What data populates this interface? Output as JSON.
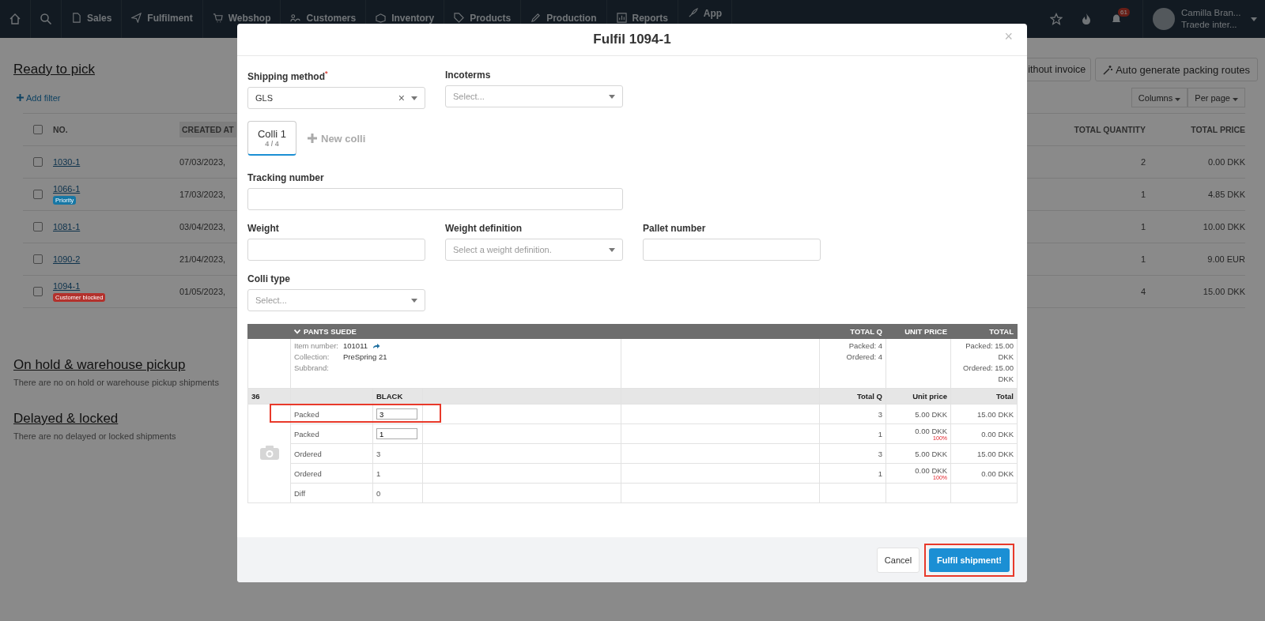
{
  "nav": {
    "items": [
      {
        "label": "Sales"
      },
      {
        "label": "Fulfilment"
      },
      {
        "label": "Webshop"
      },
      {
        "label": "Customers"
      },
      {
        "label": "Inventory"
      },
      {
        "label": "Products"
      },
      {
        "label": "Production"
      },
      {
        "label": "Reports"
      },
      {
        "label": "App"
      }
    ],
    "notification_count": "61",
    "user": {
      "name": "Camilla Bran...",
      "company": "Traede inter..."
    }
  },
  "page": {
    "title": "Ready to pick",
    "add_filter": "Add filter",
    "buttons": [
      "ithout invoice",
      "Auto generate packing routes"
    ],
    "table_controls": [
      "Columns",
      "Per page"
    ],
    "columns": [
      "NO.",
      "CREATED AT",
      "TOTAL QUANTITY",
      "TOTAL PRICE"
    ],
    "header_checked": false,
    "rows": [
      {
        "checked": false,
        "no": "1030-1",
        "created": "07/03/2023,",
        "quantity": "2",
        "price": "0.00 DKK"
      },
      {
        "checked": false,
        "no": "1066-1",
        "tag": {
          "label": "Priority",
          "color": "#1677a5"
        },
        "created": "17/03/2023,",
        "quantity": "1",
        "price": "4.85 DKK"
      },
      {
        "checked": false,
        "no": "1081-1",
        "created": "03/04/2023,",
        "quantity": "1",
        "price": "10.00 DKK"
      },
      {
        "checked": false,
        "no": "1090-2",
        "created": "21/04/2023,",
        "quantity": "1",
        "price": "9.00 EUR"
      },
      {
        "checked": false,
        "no": "1094-1",
        "tag": {
          "label": "Customer blocked",
          "color": "#b3312c"
        },
        "created": "01/05/2023,",
        "quantity": "4",
        "price": "15.00 DKK"
      }
    ],
    "sections": [
      {
        "title": "On hold & warehouse pickup",
        "empty_text": "There are no on hold or warehouse pickup shipments"
      },
      {
        "title": "Delayed & locked",
        "empty_text": "There are no delayed or locked shipments"
      }
    ]
  },
  "modal": {
    "title": "Fulfil 1094-1",
    "close": "×",
    "shipping_method": {
      "label": "Shipping method",
      "required_mark": "*",
      "value": "GLS",
      "clear": "×"
    },
    "incoterms": {
      "label": "Incoterms",
      "placeholder": "Select..."
    },
    "colli_tabs": [
      {
        "label": "Colli 1",
        "count": "4 / 4",
        "selected": true
      }
    ],
    "new_colli": "New colli",
    "tracking_number": {
      "label": "Tracking number"
    },
    "weight": {
      "label": "Weight"
    },
    "weight_definition": {
      "label": "Weight definition",
      "placeholder": "Select a weight definition."
    },
    "pallet_number": {
      "label": "Pallet number"
    },
    "colli_type": {
      "label": "Colli type",
      "placeholder": "Select..."
    },
    "product": {
      "name": "PANTS SUEDE",
      "columns": [
        "TOTAL Q",
        "UNIT PRICE",
        "TOTAL"
      ],
      "info": [
        {
          "label": "Item number:",
          "value": "101011",
          "link": true
        },
        {
          "label": "Collection:",
          "value": "PreSpring 21",
          "link": false
        },
        {
          "label": "Subbrand:",
          "link": false
        }
      ],
      "total_q": [
        "Packed: 4",
        "Ordered: 4"
      ],
      "total": [
        "Packed: 15.00 DKK",
        "Ordered: 15.00 DKK"
      ],
      "size": "36",
      "variant": "BLACK",
      "variant_columns": [
        "Total Q",
        "Unit price",
        "Total"
      ],
      "lines": [
        {
          "kind": "input",
          "label": "Packed",
          "value": "3",
          "total_q": "3",
          "unit_price": "5.00 DKK",
          "total": "15.00 DKK",
          "highlighted": true
        },
        {
          "kind": "input",
          "label": "Packed",
          "value": "1",
          "total_q": "1",
          "unit_price": "0.00 DKK",
          "discount": "100%",
          "total": "0.00 DKK",
          "highlighted": false
        },
        {
          "kind": "text",
          "label": "Ordered",
          "value": "3",
          "total_q": "3",
          "unit_price": "5.00 DKK",
          "total": "15.00 DKK",
          "highlighted": false
        },
        {
          "kind": "text",
          "label": "Ordered",
          "value": "1",
          "total_q": "1",
          "unit_price": "0.00 DKK",
          "discount": "100%",
          "total": "0.00 DKK",
          "highlighted": false
        },
        {
          "kind": "text",
          "label": "Diff",
          "value": "0",
          "highlighted": false
        }
      ]
    },
    "footer": {
      "cancel": "Cancel",
      "submit": {
        "label": "Fulfil shipment!",
        "highlighted": true
      }
    }
  }
}
